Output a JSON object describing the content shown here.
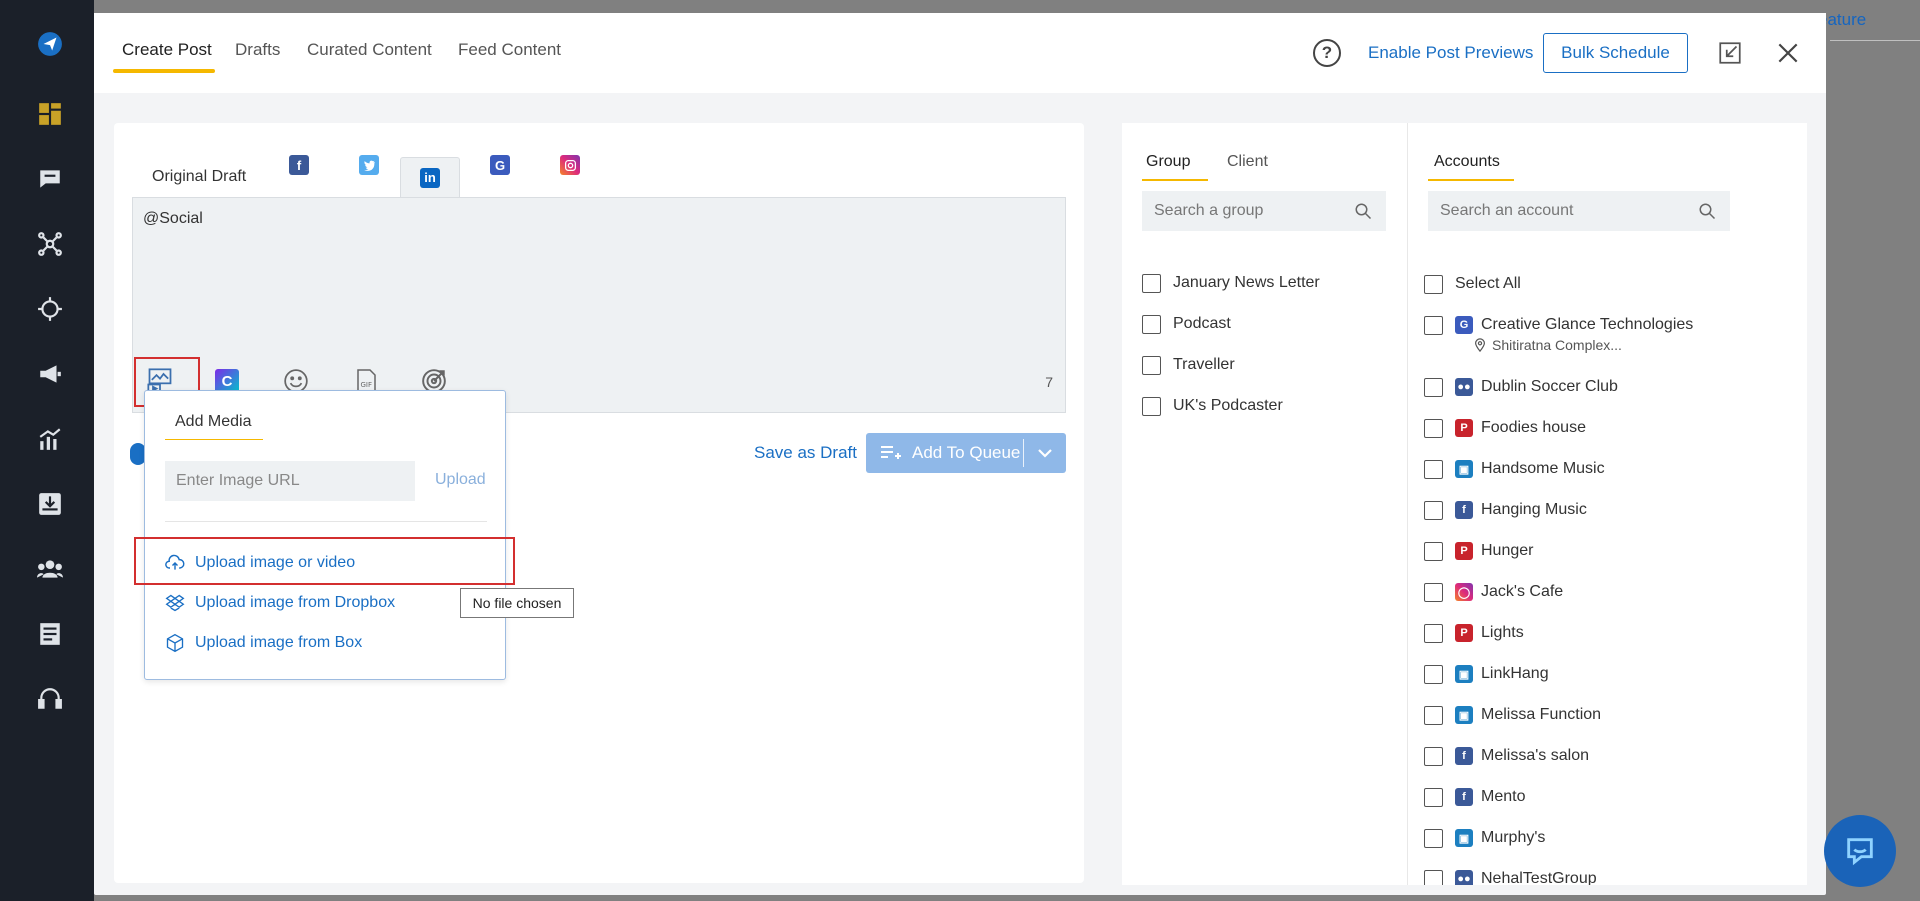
{
  "header": {
    "tabs": [
      {
        "label": "Create Post"
      },
      {
        "label": "Drafts"
      },
      {
        "label": "Curated Content"
      },
      {
        "label": "Feed Content"
      }
    ],
    "enable_previews": "Enable Post Previews",
    "bulk_schedule": "Bulk Schedule",
    "help": "?"
  },
  "background": {
    "feature_link": "eature"
  },
  "editor": {
    "original_draft": "Original Draft",
    "networks": [
      "facebook",
      "twitter",
      "linkedin",
      "google-business",
      "instagram"
    ],
    "active_network": "linkedin",
    "text": "@Social",
    "char_count": "7",
    "tools": [
      "add-media-icon",
      "canva-icon",
      "emoji-icon",
      "gif-icon",
      "target-icon"
    ],
    "save_as_draft": "Save as Draft",
    "add_to_queue": "Add To Queue"
  },
  "media_menu": {
    "tab": "Add Media",
    "url_placeholder": "Enter Image URL",
    "upload": "Upload",
    "items": [
      {
        "label": "Upload image or video",
        "icon": "cloud-upload-icon"
      },
      {
        "label": "Upload image from Dropbox",
        "icon": "dropbox-icon"
      },
      {
        "label": "Upload image from Box",
        "icon": "box-icon"
      }
    ],
    "tooltip": "No file chosen"
  },
  "groups": {
    "tabs": [
      {
        "label": "Group"
      },
      {
        "label": "Client"
      }
    ],
    "search_placeholder": "Search a group",
    "items": [
      {
        "label": "January News Letter"
      },
      {
        "label": "Podcast"
      },
      {
        "label": "Traveller"
      },
      {
        "label": "UK's Podcaster"
      }
    ]
  },
  "accounts": {
    "tab": "Accounts",
    "search_placeholder": "Search an account",
    "select_all": "Select All",
    "items": [
      {
        "label": "Creative Glance Technologies",
        "sub": "Shitiratna Complex...",
        "network": "google-business",
        "color": "#3b5bbd"
      },
      {
        "label": "Dublin Soccer Club",
        "network": "facebook-group",
        "color": "#3b5998"
      },
      {
        "label": "Foodies house",
        "network": "pinterest",
        "color": "#c8232c"
      },
      {
        "label": "Handsome Music",
        "network": "linkedin-page",
        "color": "#1c7fc0"
      },
      {
        "label": "Hanging Music",
        "network": "facebook",
        "color": "#3b5998"
      },
      {
        "label": "Hunger",
        "network": "pinterest",
        "color": "#c8232c"
      },
      {
        "label": "Jack's Cafe",
        "network": "instagram",
        "color": "#d6249f"
      },
      {
        "label": "Lights",
        "network": "pinterest",
        "color": "#c8232c"
      },
      {
        "label": "LinkHang",
        "network": "linkedin-page",
        "color": "#1c7fc0"
      },
      {
        "label": "Melissa Function",
        "network": "linkedin-page",
        "color": "#1c7fc0"
      },
      {
        "label": "Melissa's salon",
        "network": "facebook",
        "color": "#3b5998"
      },
      {
        "label": "Mento",
        "network": "facebook",
        "color": "#3b5998"
      },
      {
        "label": "Murphy's",
        "network": "linkedin-page",
        "color": "#1c7fc0"
      },
      {
        "label": "NehalTestGroup",
        "network": "facebook-group",
        "color": "#3b5998"
      }
    ]
  },
  "colors": {
    "accent": "#1a6fc4",
    "tab_underline": "#f5b800",
    "sidebar": "#1b2029",
    "highlight": "#d32f2f"
  }
}
